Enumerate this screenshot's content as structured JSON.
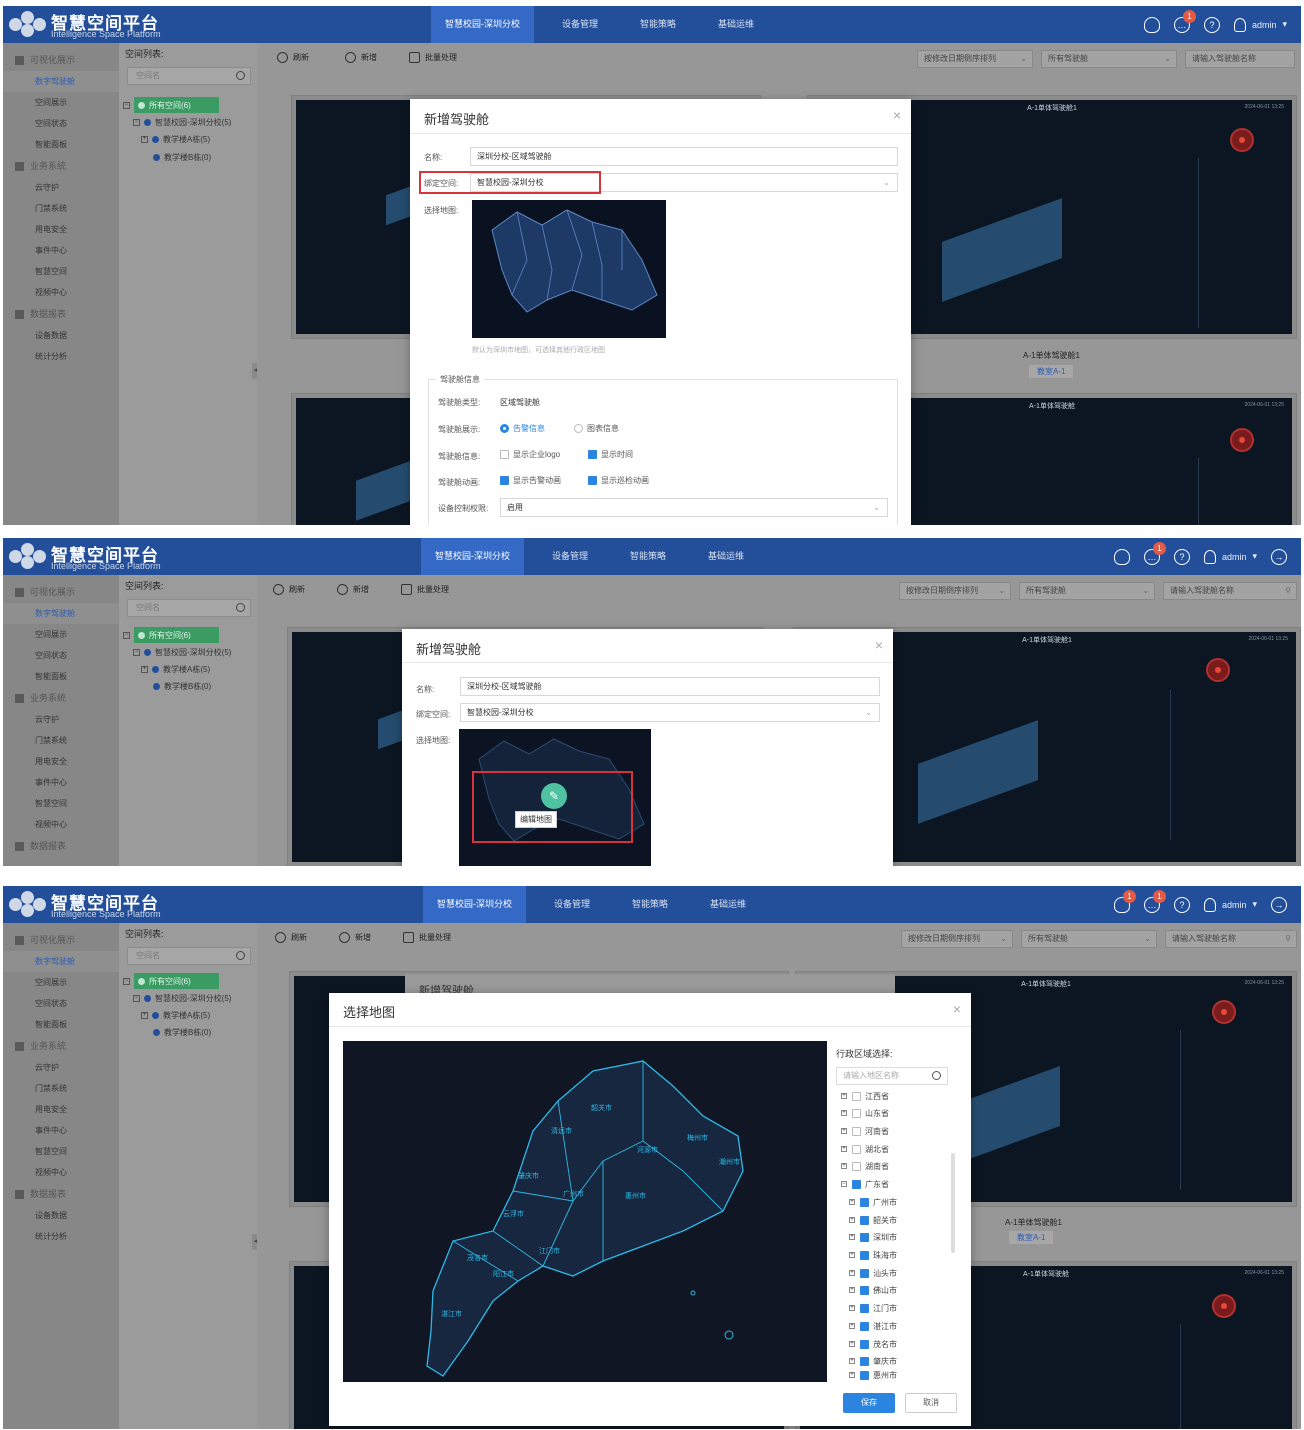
{
  "app": {
    "title": "智慧空间平台",
    "subtitle": "Intelligence Space Platform"
  },
  "nav": [
    "智慧校园-深圳分校",
    "设备管理",
    "智能策略",
    "基础运维"
  ],
  "header": {
    "user": "admin",
    "notification_badge": "1",
    "message_badge": "1",
    "message_badge_2": "1"
  },
  "sidebar": {
    "groups": [
      {
        "label": "可视化展示",
        "items": [
          "数字驾驶舱",
          "空间展示",
          "空间状态",
          "智能面板"
        ]
      },
      {
        "label": "业务系统",
        "items": [
          "云守护",
          "门禁系统",
          "用电安全",
          "事件中心",
          "智慧空间",
          "视频中心"
        ]
      },
      {
        "label": "数据报表",
        "items": [
          "设备数据",
          "统计分析"
        ]
      }
    ]
  },
  "tree": {
    "title": "空间列表:",
    "search_placeholder": "空间名",
    "nodes": [
      "所有空间(6)",
      "智慧校园-深圳分校(5)",
      "教学楼A栋(5)",
      "教学楼B栋(0)"
    ]
  },
  "toolbar": {
    "refresh": "刷新",
    "add": "新增",
    "batch": "批量处理",
    "sort": "按修改日期倒序排列",
    "filter": "所有驾驶舱",
    "search_placeholder": "请输入驾驶舱名称"
  },
  "cards": {
    "title1": "A-1单体驾驶舱1",
    "title2": "A-1单体驾驶舱",
    "caption": "A-1单体驾驶舱1",
    "tag": "教室A-1",
    "time": "2024-06-01 13:25"
  },
  "modal_add": {
    "title": "新增驾驶舱",
    "name_label": "名称:",
    "name_value": "深圳分校-区域驾驶舱",
    "bind_label": "绑定空间:",
    "bind_value": "智慧校园-深圳分校",
    "map_label": "选择地图:",
    "map_hint": "默认为深圳市地图，可选择其他行政区地图",
    "section": "驾驶舱信息",
    "type_label": "驾驶舱类型:",
    "type_value": "区域驾驶舱",
    "display_label": "驾驶舱展示:",
    "display_opt1": "告警信息",
    "display_opt2": "图表信息",
    "info_label": "驾驶舱信息:",
    "info_opt1": "显示企业logo",
    "info_opt2": "显示时间",
    "anim_label": "驾驶舱动画:",
    "anim_opt1": "显示告警动画",
    "anim_opt2": "显示巡检动画",
    "perm_label": "设备控制权限:",
    "perm_value": "启用",
    "edit_map": "编辑地图"
  },
  "modal_map": {
    "title": "选择地图",
    "region_title": "行政区域选择:",
    "region_placeholder": "请输入地区名称",
    "provinces": [
      "江西省",
      "山东省",
      "河南省",
      "湖北省",
      "湖南省",
      "广东省"
    ],
    "cities": [
      "广州市",
      "韶关市",
      "深圳市",
      "珠海市",
      "汕头市",
      "佛山市",
      "江门市",
      "湛江市",
      "茂名市",
      "肇庆市",
      "惠州市"
    ],
    "save": "保存",
    "cancel": "取消"
  },
  "map_labels": [
    "韶关市",
    "清远市",
    "河源市",
    "梅州市",
    "潮州市",
    "肇庆市",
    "广州市",
    "惠州市",
    "云浮市",
    "江门市",
    "茂名市",
    "阳江市",
    "湛江市"
  ]
}
